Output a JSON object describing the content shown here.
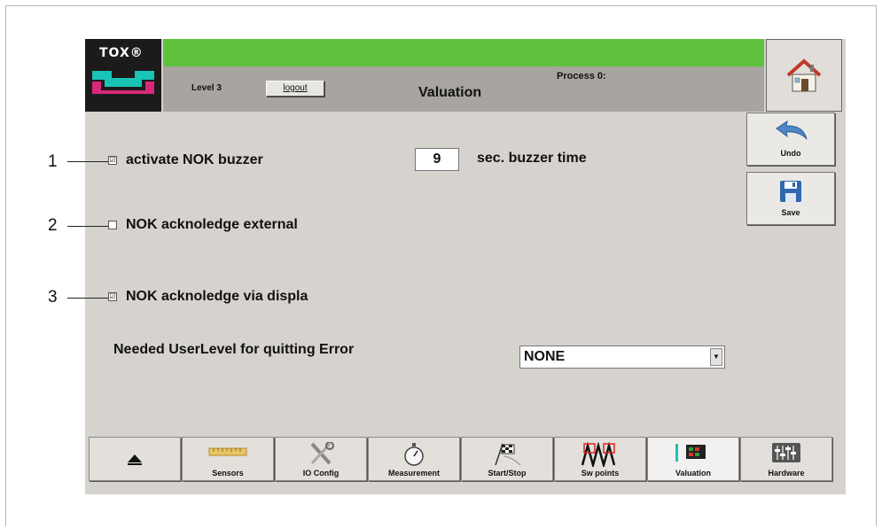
{
  "header": {
    "logo_text": "TOX®",
    "level": "Level 3",
    "logout_label": "logout",
    "title": "Valuation",
    "process": "Process 0:"
  },
  "side_buttons": {
    "undo_label": "Undo",
    "save_label": "Save"
  },
  "callouts": [
    "1",
    "2",
    "3"
  ],
  "options": {
    "buzzer": {
      "label": "activate NOK buzzer",
      "checked": true,
      "mark": "☑"
    },
    "external": {
      "label": "NOK acknoledge external",
      "checked": false,
      "mark": ""
    },
    "display": {
      "label": "NOK acknoledge via displa",
      "checked": true,
      "mark": "☑"
    }
  },
  "buzzer_time": {
    "value": "9",
    "label": "sec. buzzer time"
  },
  "userlevel": {
    "label": "Needed UserLevel for quitting Error",
    "selected": "NONE"
  },
  "nav": [
    {
      "label": "",
      "icon": "eject-icon"
    },
    {
      "label": "Sensors",
      "icon": "sensor-ruler-icon"
    },
    {
      "label": "IO Config",
      "icon": "tools-icon"
    },
    {
      "label": "Measurement",
      "icon": "stopwatch-icon"
    },
    {
      "label": "Start/Stop",
      "icon": "checkered-flag-icon"
    },
    {
      "label": "Sw points",
      "icon": "switch-points-icon"
    },
    {
      "label": "Valuation",
      "icon": "valuation-icon",
      "active": true
    },
    {
      "label": "Hardware",
      "icon": "sliders-icon"
    }
  ],
  "colors": {
    "green_bar": "#5fc23d",
    "panel": "#d6d3ce",
    "logo_teal": "#19c3b6",
    "logo_magenta": "#d8287a"
  }
}
